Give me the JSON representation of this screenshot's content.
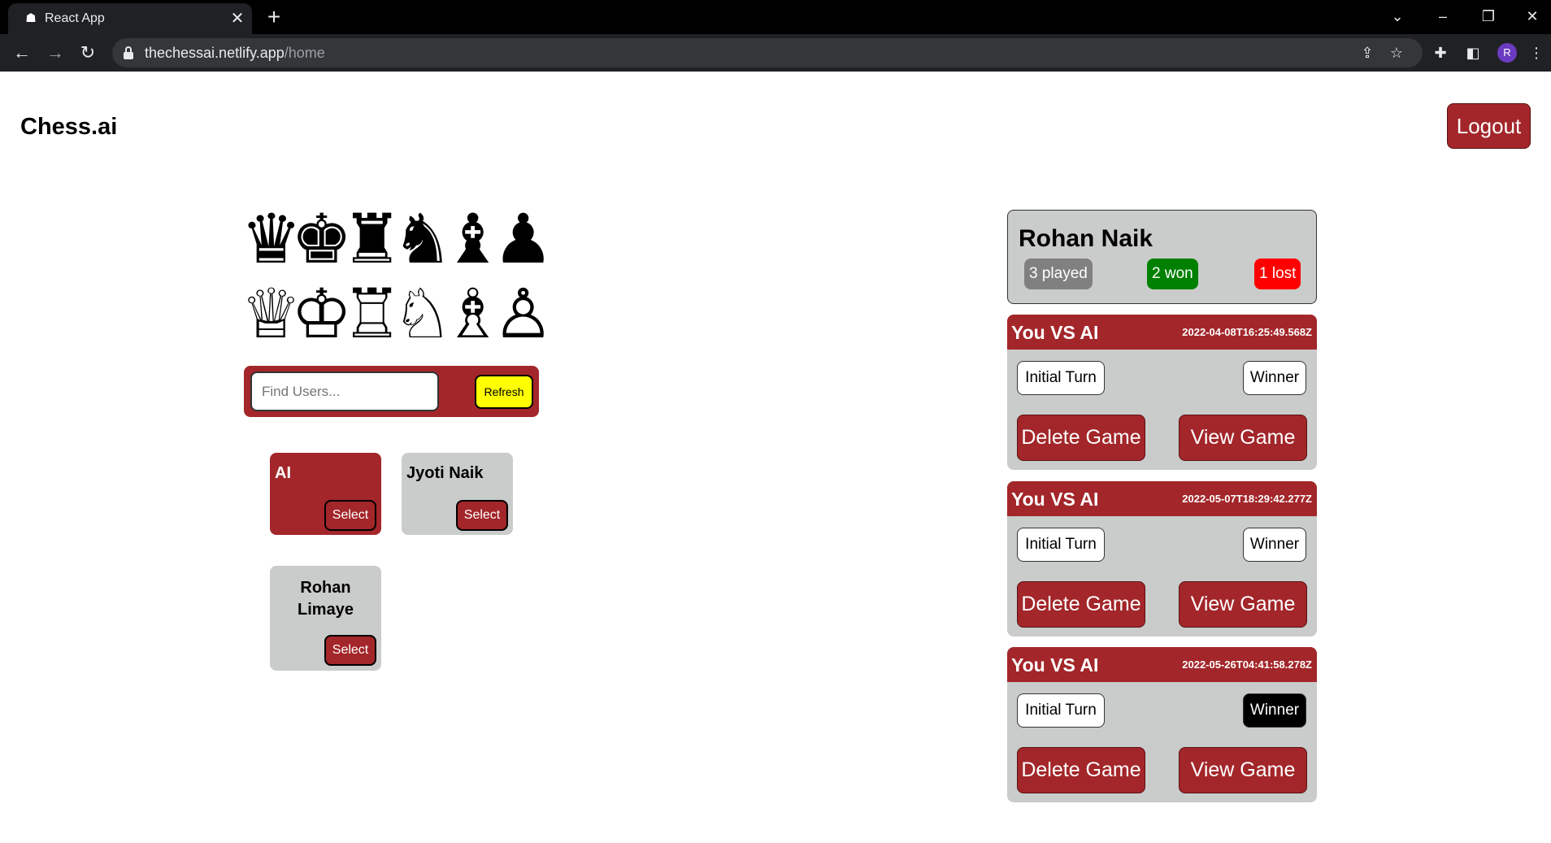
{
  "browser": {
    "tab_title": "React App",
    "url_host": "thechessai.netlify.app",
    "url_path": "/home",
    "profile_initial": "R"
  },
  "header": {
    "brand": "Chess.ai",
    "logout_label": "Logout"
  },
  "pieces": {
    "black": [
      "♛",
      "♚",
      "♜",
      "♞",
      "♝",
      "♟"
    ],
    "white": [
      "♕",
      "♔",
      "♖",
      "♘",
      "♗",
      "♙"
    ]
  },
  "search": {
    "placeholder": "Find Users...",
    "refresh_label": "Refresh"
  },
  "users": [
    {
      "name": "AI",
      "select_label": "Select",
      "active": true
    },
    {
      "name": "Jyoti Naik",
      "select_label": "Select",
      "active": false
    },
    {
      "name": "Rohan Limaye",
      "select_label": "Select",
      "active": false
    }
  ],
  "profile": {
    "name": "Rohan Naik",
    "played": "3 played",
    "won": "2 won",
    "lost": "1 lost"
  },
  "games": [
    {
      "title": "You VS AI",
      "date": "2022-04-08T16:25:49.568Z",
      "initial_turn": "Initial Turn",
      "winner": "Winner",
      "winner_dark": false,
      "delete_label": "Delete Game",
      "view_label": "View Game"
    },
    {
      "title": "You VS AI",
      "date": "2022-05-07T18:29:42.277Z",
      "initial_turn": "Initial Turn",
      "winner": "Winner",
      "winner_dark": false,
      "delete_label": "Delete Game",
      "view_label": "View Game"
    },
    {
      "title": "You VS AI",
      "date": "2022-05-26T04:41:58.278Z",
      "initial_turn": "Initial Turn",
      "winner": "Winner",
      "winner_dark": true,
      "delete_label": "Delete Game",
      "view_label": "View Game"
    }
  ],
  "colors": {
    "accent": "#a3262a",
    "card": "#c9ccca",
    "played": "#808080",
    "won": "#008000",
    "lost": "#ff0000",
    "refresh": "#ffff00"
  }
}
